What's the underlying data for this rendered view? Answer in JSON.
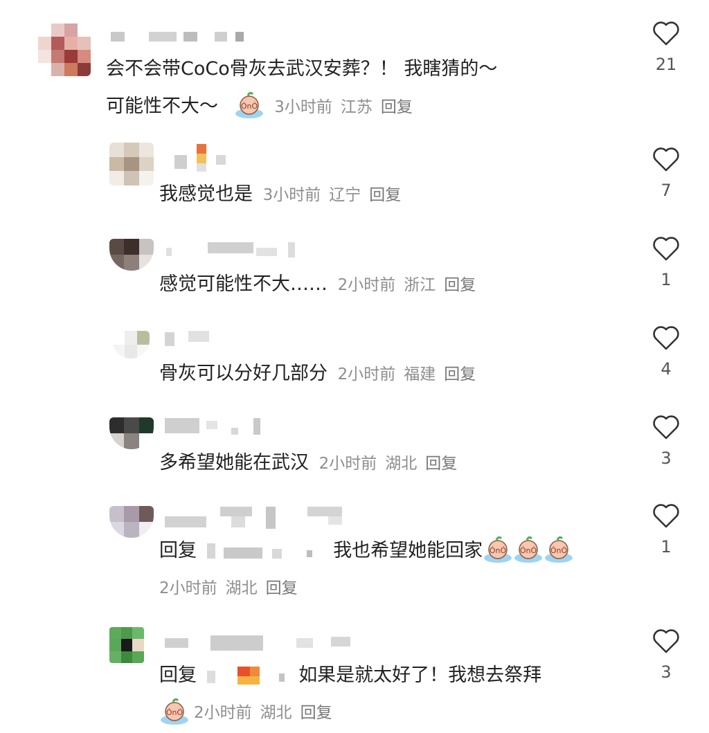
{
  "comments": [
    {
      "text_line1": "会不会带CoCo骨灰去武汉安葬？！ 我瞎猜的～",
      "text_line2": "可能性不大～",
      "time": "3小时前",
      "location": "江苏",
      "reply": "回复",
      "likes": "21"
    },
    {
      "text": "我感觉也是",
      "time": "3小时前",
      "location": "辽宁",
      "reply": "回复",
      "likes": "7"
    },
    {
      "text": "感觉可能性不大……",
      "time": "2小时前",
      "location": "浙江",
      "reply": "回复",
      "likes": "1"
    },
    {
      "text": "骨灰可以分好几部分",
      "time": "2小时前",
      "location": "福建",
      "reply": "回复",
      "likes": "4"
    },
    {
      "text": "多希望她能在武汉",
      "time": "2小时前",
      "location": "湖北",
      "reply": "回复",
      "likes": "3"
    },
    {
      "prefix": "回复",
      "text": "我也希望她能回家",
      "time": "2小时前",
      "location": "湖北",
      "reply": "回复",
      "likes": "1"
    },
    {
      "prefix": "回复",
      "text": "如果是就太好了！我想去祭拜",
      "time": "2小时前",
      "location": "湖北",
      "reply": "回复",
      "likes": "3"
    }
  ],
  "icons": {
    "like": "heart-outline-icon",
    "emoji": "crying-emoji-icon"
  },
  "colors": {
    "text": "#222222",
    "meta": "#8e8e8e",
    "heart_stroke": "#333333"
  }
}
